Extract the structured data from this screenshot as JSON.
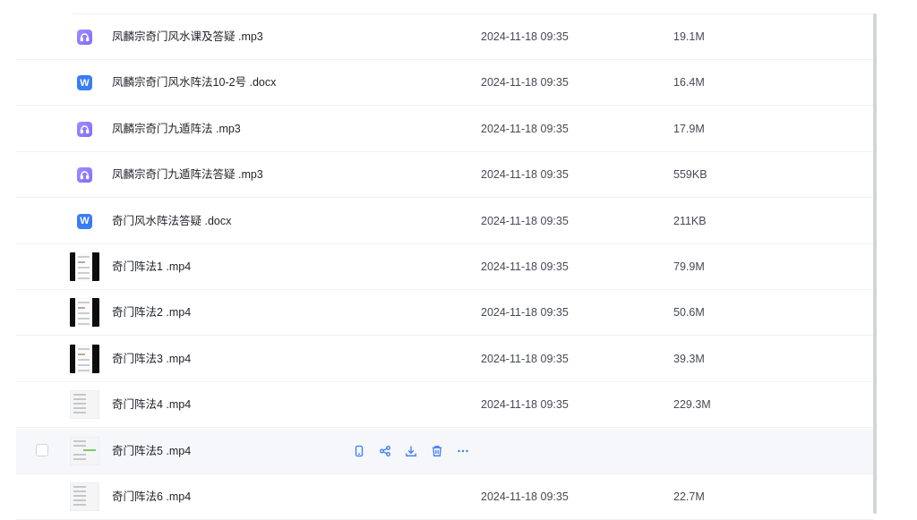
{
  "files": [
    {
      "name": "凤麟宗奇门风水课及答疑 .mp3",
      "date": "2024-11-18 09:35",
      "size": "19.1M",
      "type": "audio",
      "icon": "audio-file-icon"
    },
    {
      "name": "凤麟宗奇门风水阵法10-2号 .docx",
      "date": "2024-11-18 09:35",
      "size": "16.4M",
      "type": "word",
      "icon": "word-file-icon"
    },
    {
      "name": "凤麟宗奇门九遁阵法 .mp3",
      "date": "2024-11-18 09:35",
      "size": "17.9M",
      "type": "audio",
      "icon": "audio-file-icon"
    },
    {
      "name": "凤麟宗奇门九遁阵法答疑 .mp3",
      "date": "2024-11-18 09:35",
      "size": "559KB",
      "type": "audio",
      "icon": "audio-file-icon"
    },
    {
      "name": "奇门风水阵法答疑 .docx",
      "date": "2024-11-18 09:35",
      "size": "211KB",
      "type": "word",
      "icon": "word-file-icon"
    },
    {
      "name": "奇门阵法1 .mp4",
      "date": "2024-11-18 09:35",
      "size": "79.9M",
      "type": "video-dark",
      "icon": "video-thumbnail"
    },
    {
      "name": "奇门阵法2 .mp4",
      "date": "2024-11-18 09:35",
      "size": "50.6M",
      "type": "video-dark",
      "icon": "video-thumbnail"
    },
    {
      "name": "奇门阵法3 .mp4",
      "date": "2024-11-18 09:35",
      "size": "39.3M",
      "type": "video-dark",
      "icon": "video-thumbnail"
    },
    {
      "name": "奇门阵法4 .mp4",
      "date": "2024-11-18 09:35",
      "size": "229.3M",
      "type": "video-light",
      "icon": "video-thumbnail"
    },
    {
      "name": "奇门阵法5 .mp4",
      "date": "",
      "size": "",
      "type": "video-light-green",
      "icon": "video-thumbnail",
      "hovered": true
    },
    {
      "name": "奇门阵法6 .mp4",
      "date": "2024-11-18 09:35",
      "size": "22.7M",
      "type": "video-light",
      "icon": "video-thumbnail"
    }
  ],
  "row_actions": [
    {
      "name": "open-on-phone-icon"
    },
    {
      "name": "share-icon"
    },
    {
      "name": "download-icon"
    },
    {
      "name": "delete-icon"
    },
    {
      "name": "more-icon"
    }
  ],
  "colors": {
    "accent": "#3a7cf6",
    "audio": "#8f79ff",
    "word": "#3a7cf6",
    "hover_row": "#f5f7fa"
  }
}
